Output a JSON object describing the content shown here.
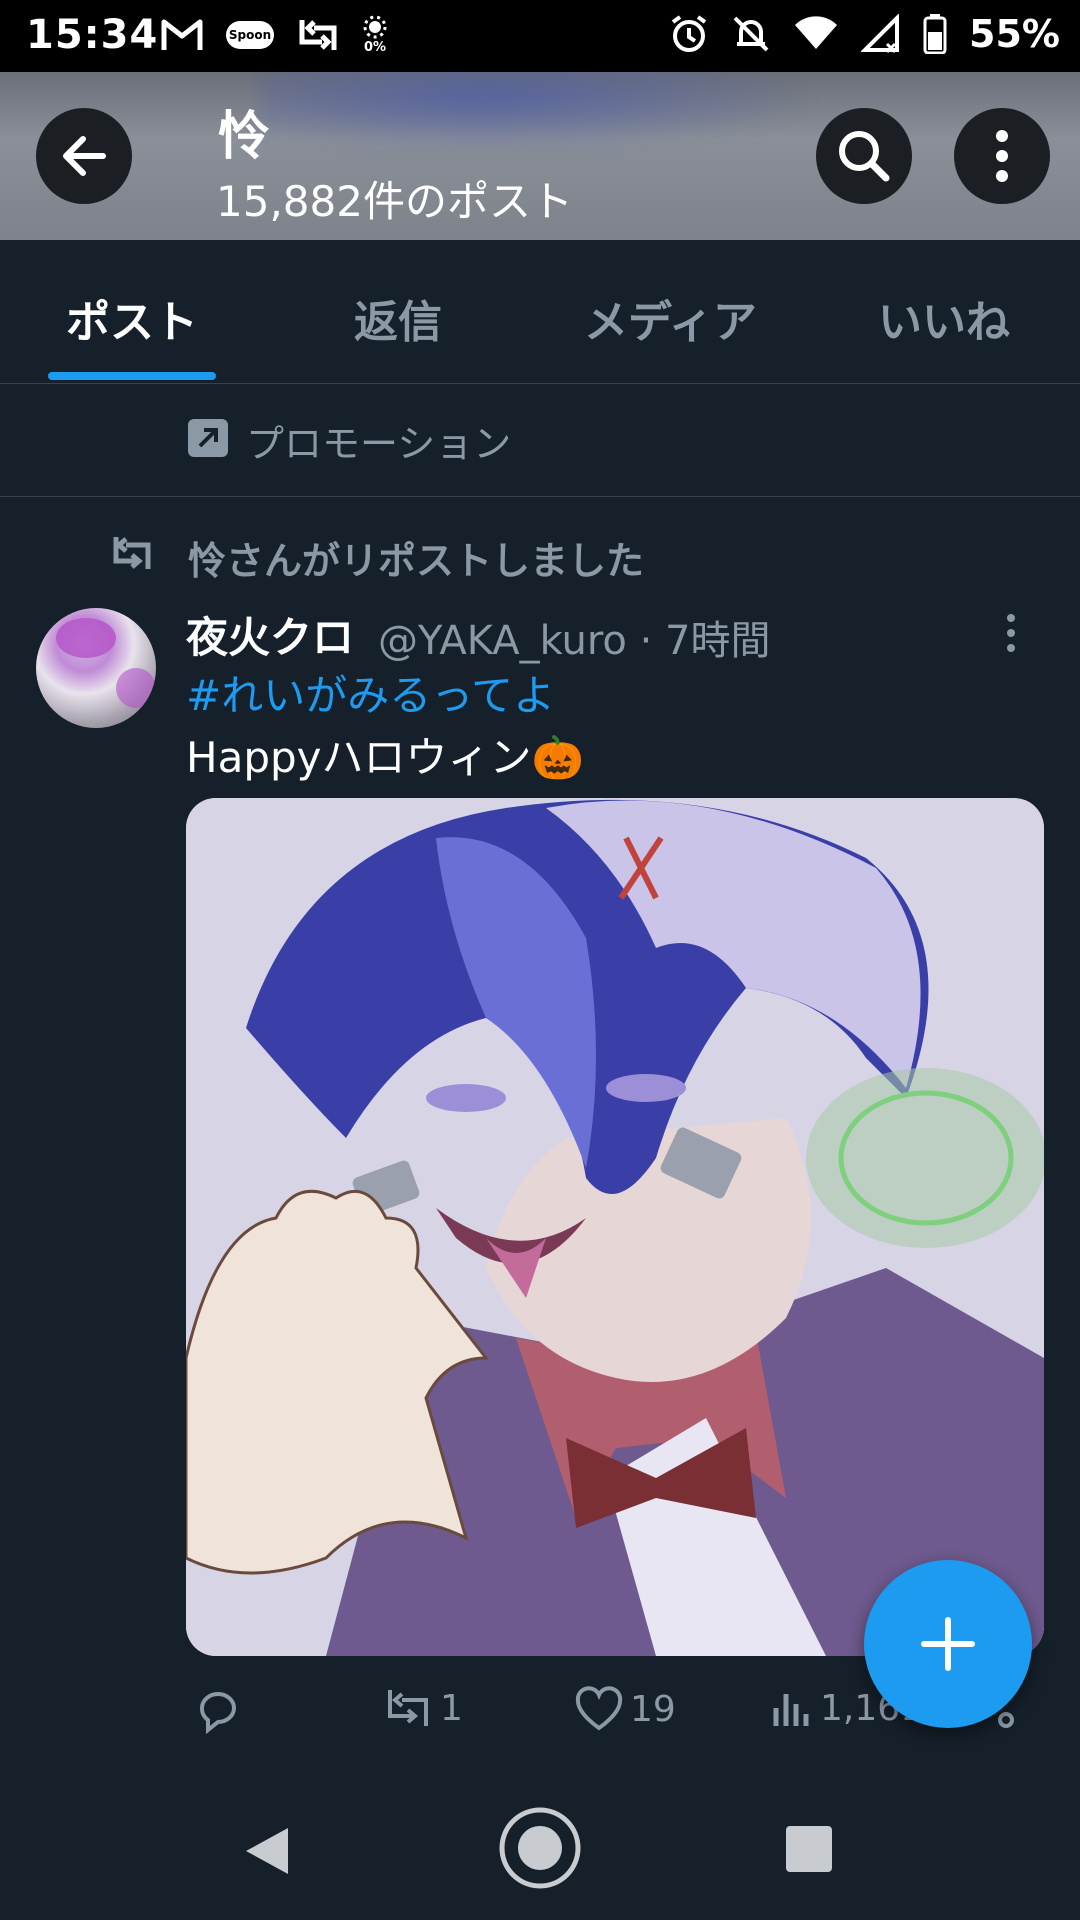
{
  "status_bar": {
    "time": "15:34",
    "gps_percent": "0%",
    "signal_label": "5",
    "battery": "55%",
    "icons_left": [
      "gmail-icon",
      "spoon-icon",
      "repost-icon",
      "brightness-icon"
    ],
    "icons_right": [
      "alarm-icon",
      "mute-icon",
      "wifi-icon",
      "signal-icon",
      "battery-icon"
    ],
    "spoon_text": "Spoon"
  },
  "header": {
    "title": "怜",
    "subtitle": "15,882件のポスト"
  },
  "tabs": [
    {
      "label": "ポスト",
      "active": true
    },
    {
      "label": "返信",
      "active": false
    },
    {
      "label": "メディア",
      "active": false
    },
    {
      "label": "いいね",
      "active": false
    }
  ],
  "promo": {
    "label": "プロモーション"
  },
  "repost": {
    "label": "怜さんがリポストしました"
  },
  "tweet": {
    "display_name": "夜火クロ",
    "meta": "@YAKA_kuro · 7時間",
    "hashtag": "#れいがみるってよ",
    "body": "Happyハロウィン🎃",
    "replies": "",
    "reposts": "1",
    "likes": "19",
    "views": "1,161"
  },
  "colors": {
    "accent": "#1d9bf0",
    "background": "#15202b",
    "muted": "#8b98a5"
  }
}
